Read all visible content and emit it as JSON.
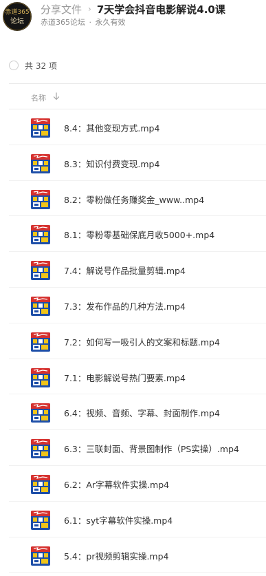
{
  "header": {
    "avatar": {
      "lines": [
        "赤道365",
        "论坛"
      ],
      "icon": "forum-logo-icon"
    },
    "breadcrumb_parent": "分享文件",
    "separator": "›",
    "title": "7天学会抖音电影解说4.0课",
    "sharer": "赤道365论坛",
    "dot": "·",
    "validity": "永久有效"
  },
  "summary": {
    "count_label": "共 32 项"
  },
  "columns": {
    "name": "名称",
    "sort_icon": "arrow-down-icon"
  },
  "files": [
    {
      "name": "8.4：其他变现方式.mp4",
      "icon": "video-thumbnail-icon"
    },
    {
      "name": "8.3：知识付费变现.mp4",
      "icon": "video-thumbnail-icon"
    },
    {
      "name": "8.2：零粉做任务赚奖金_www..mp4",
      "icon": "video-thumbnail-icon"
    },
    {
      "name": "8.1：零粉零基础保底月收5000+.mp4",
      "icon": "video-thumbnail-icon"
    },
    {
      "name": "7.4：解说号作品批量剪辑.mp4",
      "icon": "video-thumbnail-icon"
    },
    {
      "name": "7.3：发布作品的几种方法.mp4",
      "icon": "video-thumbnail-icon"
    },
    {
      "name": "7.2：如何写一吸引人的文案和标题.mp4",
      "icon": "video-thumbnail-icon"
    },
    {
      "name": "7.1：电影解说号热门要素.mp4",
      "icon": "video-thumbnail-icon"
    },
    {
      "name": "6.4：视频、音频、字幕、封面制作.mp4",
      "icon": "video-thumbnail-icon"
    },
    {
      "name": "6.3：三联封面、背景图制作（PS实操）.mp4",
      "icon": "video-thumbnail-icon"
    },
    {
      "name": "6.2：Ar字幕软件实操.mp4",
      "icon": "video-thumbnail-icon"
    },
    {
      "name": "6.1：syt字幕软件实操.mp4",
      "icon": "video-thumbnail-icon"
    },
    {
      "name": "5.4：pr视频剪辑实操.mp4",
      "icon": "video-thumbnail-icon"
    }
  ],
  "colors": {
    "thumbnail_red": "#d6322f",
    "thumbnail_blue": "#1e4fa8",
    "thumbnail_yellow": "#f0c419",
    "avatar_bg": "#141414",
    "avatar_gold": "#d8b35a"
  }
}
